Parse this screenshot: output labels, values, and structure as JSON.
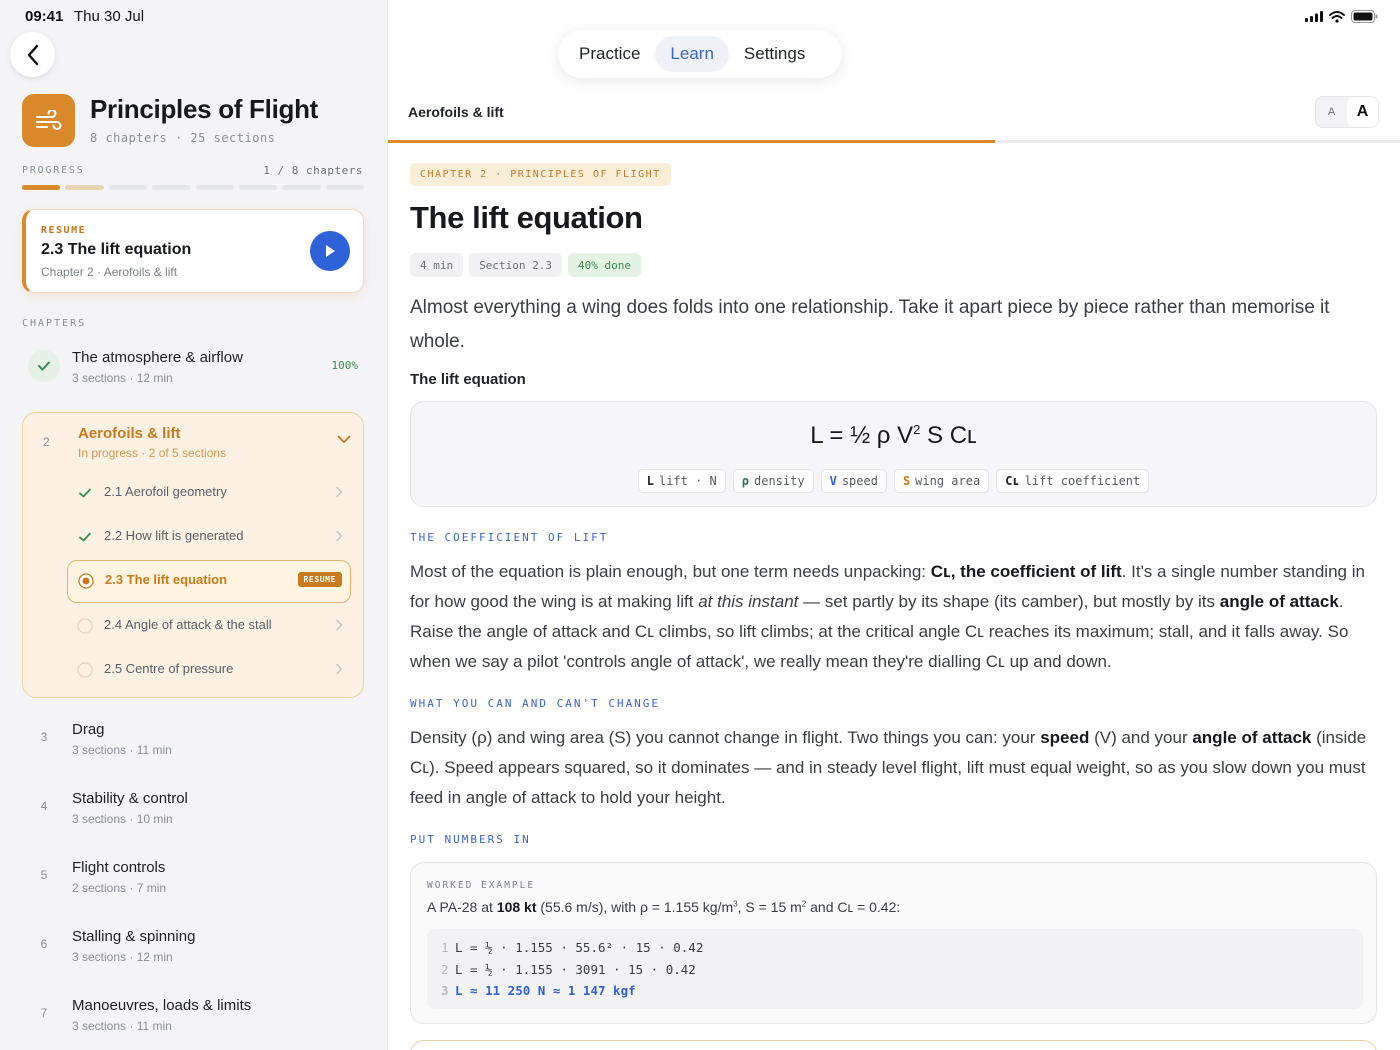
{
  "status": {
    "time": "09:41",
    "date": "Thu 30 Jul"
  },
  "course": {
    "title": "Principles of Flight",
    "meta": "8 chapters · 25 sections"
  },
  "progress": {
    "label": "PROGRESS",
    "count": "1 / 8 chapters",
    "completed_fraction": 0.125
  },
  "resume": {
    "kicker": "RESUME",
    "title": "2.3 The lift equation",
    "subtitle": "Chapter 2 · Aerofoils & lift"
  },
  "chapters_label": "CHAPTERS",
  "chapters": [
    {
      "title": "The atmosphere & airflow",
      "subtitle": "3 sections · 12 min",
      "pct": "100%"
    },
    {
      "num": "2",
      "title": "Aerofoils & lift",
      "subtitle": "In progress · 2 of 5 sections"
    },
    {
      "num": "3",
      "title": "Drag",
      "subtitle": "3 sections · 11 min"
    },
    {
      "num": "4",
      "title": "Stability & control",
      "subtitle": "3 sections · 10 min"
    },
    {
      "num": "5",
      "title": "Flight controls",
      "subtitle": "2 sections · 7 min"
    },
    {
      "num": "6",
      "title": "Stalling & spinning",
      "subtitle": "3 sections · 12 min"
    },
    {
      "num": "7",
      "title": "Manoeuvres, loads & limits",
      "subtitle": "3 sections · 11 min"
    }
  ],
  "sections": [
    {
      "label": "2.1 Aerofoil geometry",
      "state": "done"
    },
    {
      "label": "2.2 How lift is generated",
      "state": "done"
    },
    {
      "label": "2.3 The lift equation",
      "state": "current",
      "badge": "RESUME"
    },
    {
      "label": "2.4 Angle of attack & the stall",
      "state": "todo"
    },
    {
      "label": "2.5 Centre of pressure",
      "state": "todo"
    }
  ],
  "tabs": {
    "practice": "Practice",
    "learn": "Learn",
    "settings": "Settings",
    "active": "Learn"
  },
  "breadcrumb": "Aerofoils & lift",
  "text_size": {
    "small": "A",
    "large": "A"
  },
  "reading_progress": 0.6,
  "lesson": {
    "kicker": "CHAPTER 2 · PRINCIPLES OF FLIGHT",
    "title": "The lift equation",
    "pills": {
      "time": "4 min",
      "section": "Section 2.3",
      "done": "40% done"
    },
    "intro": "Almost everything a wing does folds into one relationship. Take it apart piece by piece rather than memorise it whole.",
    "equation_label": "The lift equation",
    "equation": {
      "lhs": "L = ½ ρ V",
      "exp": "2",
      "rhs": " S Cʟ"
    },
    "terms": [
      {
        "sym": "L",
        "desc": "lift · N"
      },
      {
        "sym": "ρ",
        "desc": "density"
      },
      {
        "sym": "V",
        "desc": "speed"
      },
      {
        "sym": "S",
        "desc": "wing area"
      },
      {
        "sym": "Cʟ",
        "desc": "lift coefficient"
      }
    ],
    "h_coefficient": "THE COEFFICIENT OF LIFT",
    "p1": {
      "a": "Most of the equation is plain enough, but one term needs unpacking: ",
      "b": "Cʟ, the coefficient of lift",
      "c": ". It's a single number standing in for how good the wing is at making lift ",
      "d": "at this instant",
      "e": " — set partly by its shape (its camber), but mostly by its ",
      "f": "angle of attack",
      "g": ". Raise the angle of attack and Cʟ climbs, so lift climbs; at the critical angle Cʟ reaches its maximum; stall, and it falls away. So when we say a pilot 'controls angle of attack', we really mean they're dialling Cʟ up and down."
    },
    "h_change": "WHAT YOU CAN AND CAN'T CHANGE",
    "p2": {
      "a": "Density (ρ) and wing area (S) you cannot change in flight. Two things you can: your ",
      "b": "speed",
      "c": " (V) and your ",
      "d": "angle of attack",
      "e": " (inside Cʟ). Speed appears squared, so it dominates — and in steady level flight, lift must equal weight, so as you slow down you must feed in angle of attack to hold your height."
    },
    "h_numbers": "PUT NUMBERS IN",
    "worked": {
      "kicker": "WORKED EXAMPLE",
      "t1": "A PA-28 at ",
      "t2": "108 kt",
      "t3": " (55.6 m/s), with ρ = 1.155 kg/m",
      "t3sup": "3",
      "t4": ", S = 15 m",
      "t4sup": "2",
      "t5": " and Cʟ = 0.42:",
      "lines": [
        {
          "n": "1",
          "code": "L = ½ · 1.155 · 55.6² · 15 · 0.42"
        },
        {
          "n": "2",
          "code": "L = ½ · 1.155 · 3091 · 15 · 0.42"
        },
        {
          "n": "3",
          "code": "L ≈ 11 250 N ≈ 1 147 kgf"
        }
      ]
    }
  }
}
